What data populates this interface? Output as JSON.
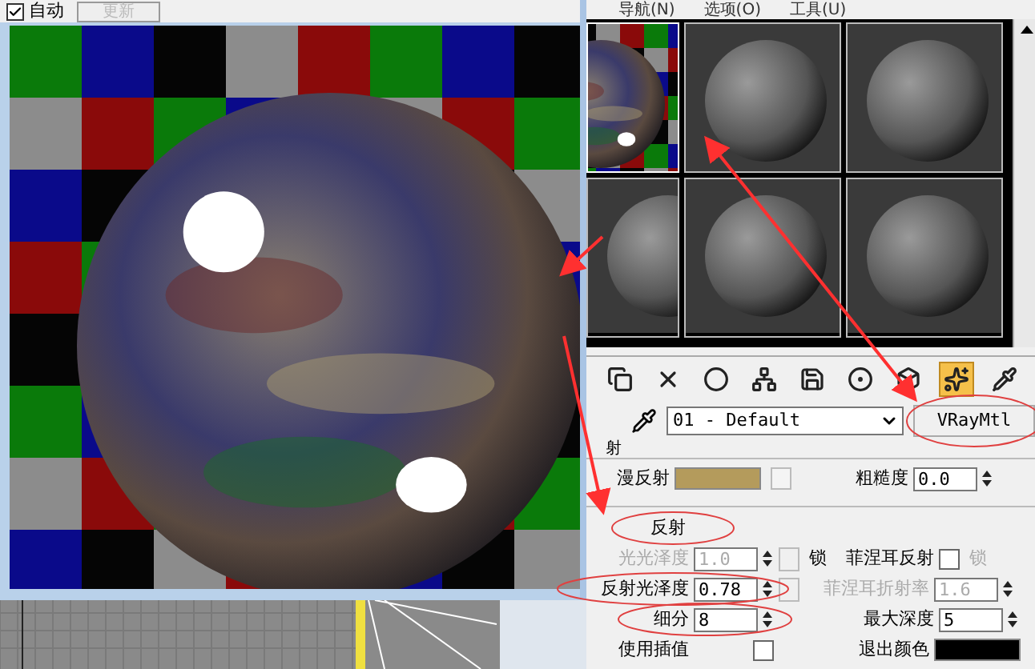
{
  "render_window": {
    "auto_update": {
      "label": "自动",
      "checked": true
    },
    "update_button": {
      "label": "更新",
      "disabled": true
    }
  },
  "menu": [
    "导航(N)",
    "选项(O)",
    "工具(U)"
  ],
  "sample_slots": [
    {
      "kind": "checker",
      "selected": true
    },
    {
      "kind": "plain",
      "selected": false
    },
    {
      "kind": "plain",
      "selected": false
    },
    {
      "kind": "plain",
      "selected": false
    },
    {
      "kind": "plain",
      "selected": false
    },
    {
      "kind": "plain",
      "selected": false
    }
  ],
  "toolbar": [
    {
      "kind": "copy",
      "selected": false
    },
    {
      "kind": "delete",
      "selected": false
    },
    {
      "kind": "sphere",
      "selected": false
    },
    {
      "kind": "tree",
      "selected": false
    },
    {
      "kind": "save",
      "selected": false
    },
    {
      "kind": "channel",
      "selected": false
    },
    {
      "kind": "cube",
      "selected": false
    },
    {
      "kind": "bars",
      "selected": true
    },
    {
      "kind": "picker",
      "selected": false
    }
  ],
  "material": {
    "name": "01 - Default",
    "type": "VRayMtl"
  },
  "section_label": "射",
  "params": {
    "diffuse": {
      "label": "漫反射",
      "color": "#b49b5c"
    },
    "roughness": {
      "label": "粗糙度",
      "value": "0.0"
    },
    "reflect": {
      "label": "反射"
    },
    "hilight_gloss": {
      "label": "光光泽度",
      "value": "1.0",
      "disabled": true
    },
    "lock": {
      "label": "锁"
    },
    "fresnel": {
      "label": "菲涅耳反射",
      "checked": false
    },
    "lock2": {
      "label": "锁",
      "disabled": true
    },
    "refl_gloss": {
      "label": "反射光泽度",
      "value": "0.78"
    },
    "fresnel_ior": {
      "label": "菲涅耳折射率",
      "value": "1.6",
      "disabled": true
    },
    "subdivs": {
      "label": "细分",
      "value": "8"
    },
    "max_depth": {
      "label": "最大深度",
      "value": "5"
    },
    "use_interp": {
      "label": "使用插值",
      "checked": false
    },
    "exit_color": {
      "label": "退出颜色",
      "color": "#000000"
    }
  }
}
